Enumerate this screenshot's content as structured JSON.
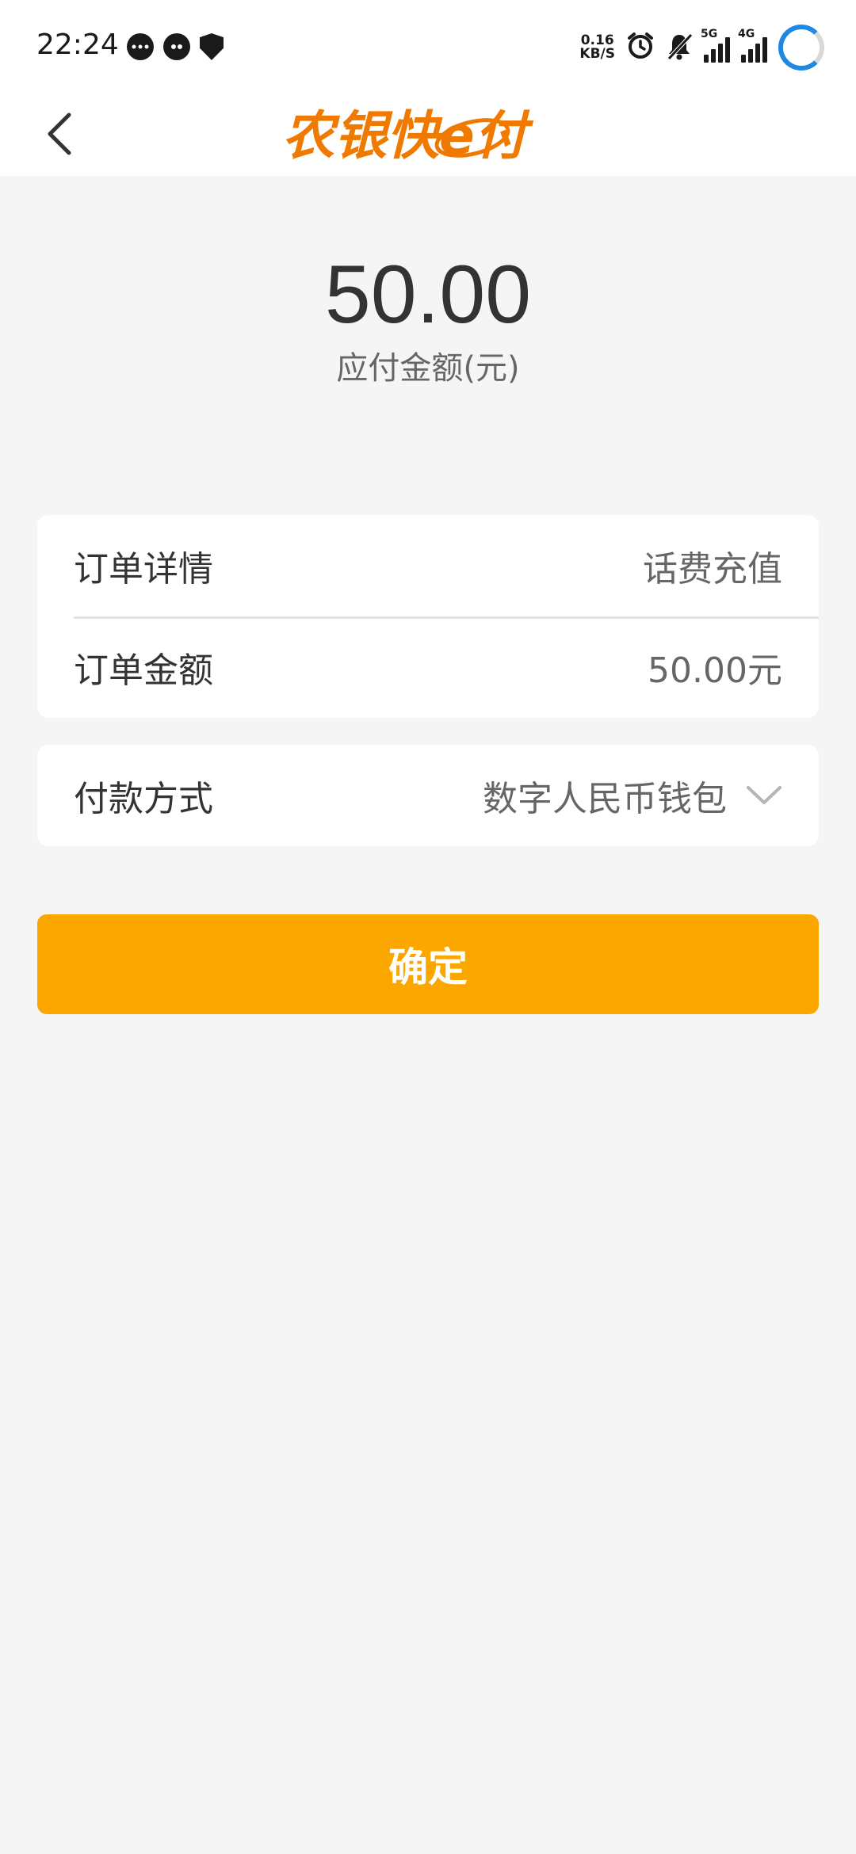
{
  "status_bar": {
    "time": "22:24",
    "net_speed_value": "0.16",
    "net_speed_unit": "KB/S",
    "signal_1_tag": "5G",
    "signal_2_tag": "4G",
    "icons": [
      "chat-bubble-icon",
      "message-icon",
      "yuan-shield-icon",
      "alarm-icon",
      "mute-bell-icon",
      "signal-icon",
      "signal-icon",
      "loading-ring-icon"
    ]
  },
  "header": {
    "logo_text": "农银快e付",
    "logo_color": "#f07a00"
  },
  "payment": {
    "amount": "50.00",
    "amount_label": "应付金额(元)"
  },
  "order": {
    "detail_label": "订单详情",
    "detail_value": "话费充值",
    "amount_label": "订单金额",
    "amount_value": "50.00元"
  },
  "method": {
    "label": "付款方式",
    "value": "数字人民币钱包"
  },
  "confirm": {
    "label": "确定",
    "color": "#fca600"
  }
}
